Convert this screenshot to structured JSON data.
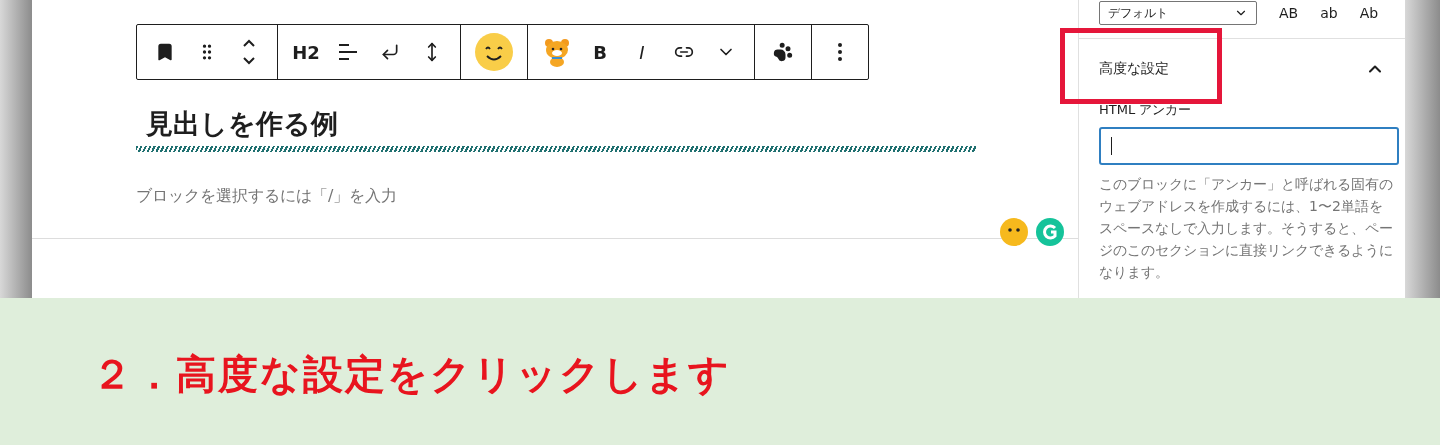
{
  "toolbar": {
    "groups": [
      [
        {
          "kind": "bookmark"
        },
        {
          "kind": "drag"
        },
        {
          "kind": "mover"
        }
      ],
      [
        {
          "kind": "heading-level",
          "label": "H2"
        },
        {
          "kind": "align"
        },
        {
          "kind": "return"
        },
        {
          "kind": "height"
        }
      ],
      [
        {
          "kind": "smiley"
        }
      ],
      [
        {
          "kind": "bear"
        },
        {
          "kind": "bold",
          "label": "B"
        },
        {
          "kind": "italic",
          "label": "I"
        },
        {
          "kind": "link"
        },
        {
          "kind": "chevron"
        }
      ],
      [
        {
          "kind": "paw"
        }
      ],
      [
        {
          "kind": "dots"
        }
      ]
    ]
  },
  "editor": {
    "heading": "見出しを作る例",
    "placeholder": "ブロックを選択するには「/」を入力"
  },
  "sidebar": {
    "select_value": "デフォルト",
    "case_options": [
      "AB",
      "ab",
      "Ab"
    ],
    "panel": {
      "title": "高度な設定",
      "expanded": true,
      "highlighted": true
    },
    "field_label": "HTML アンカー",
    "field_focused": true,
    "help": "このブロックに「アンカー」と呼ばれる固有のウェブアドレスを作成するには、1〜2単語をスペースなしで入力します。そうすると、ページのこのセクションに直接リンクできるようになります。"
  },
  "caption": "２．高度な設定をクリックします"
}
